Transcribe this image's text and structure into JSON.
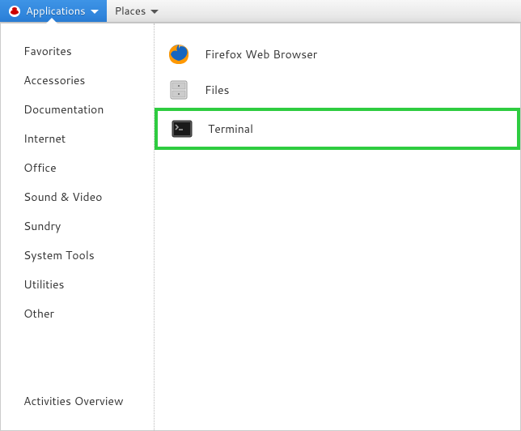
{
  "panel": {
    "applications_label": "Applications",
    "places_label": "Places"
  },
  "menu": {
    "categories": [
      "Favorites",
      "Accessories",
      "Documentation",
      "Internet",
      "Office",
      "Sound & Video",
      "Sundry",
      "System Tools",
      "Utilities",
      "Other"
    ],
    "activities_label": "Activities Overview",
    "apps": [
      {
        "label": "Firefox Web Browser",
        "icon": "firefox-icon"
      },
      {
        "label": "Files",
        "icon": "files-icon"
      },
      {
        "label": "Terminal",
        "icon": "terminal-icon"
      }
    ],
    "highlighted_app_index": 2
  }
}
